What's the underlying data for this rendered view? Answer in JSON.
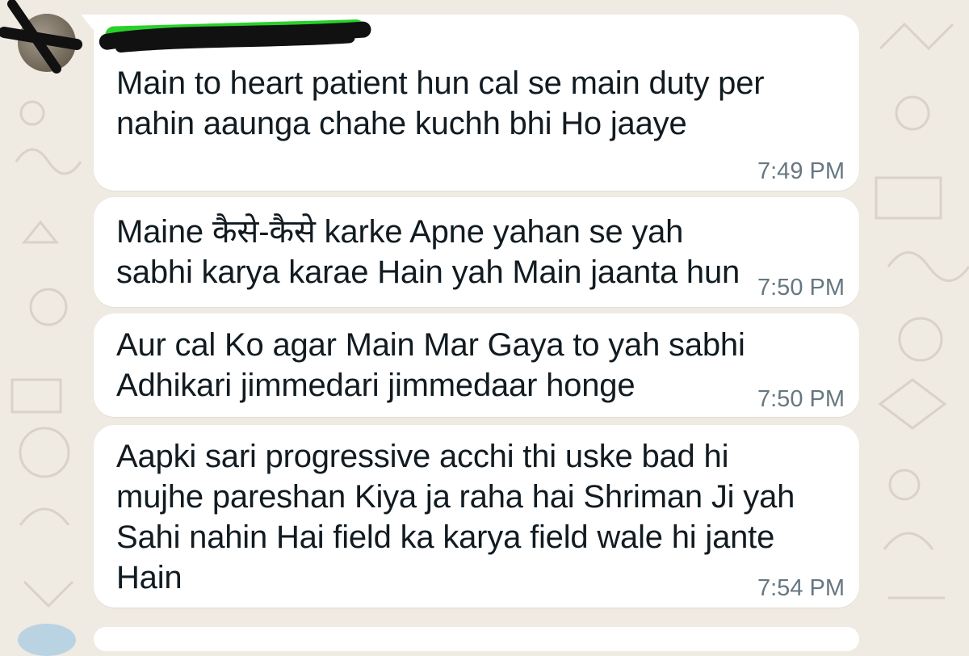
{
  "chat": {
    "sender_name": "",
    "messages": [
      {
        "text": "Main to heart patient hun cal se main duty per nahin aaunga chahe kuchh bhi Ho jaaye",
        "time": "7:49 PM"
      },
      {
        "text": "Maine कैसे-कैसे karke Apne yahan se yah sabhi karya karae Hain yah Main jaanta hun",
        "time": "7:50 PM"
      },
      {
        "text": "Aur cal Ko agar Main Mar Gaya to yah sabhi Adhikari jimmedari jimmedaar honge",
        "time": "7:50 PM"
      },
      {
        "text": "Aapki sari progressive acchi thi uske bad hi mujhe pareshan Kiya ja raha hai Shriman Ji yah Sahi nahin Hai field ka karya field wale hi jante Hain",
        "time": "7:54 PM"
      }
    ]
  },
  "colors": {
    "background": "#efeae2",
    "bubble": "#ffffff",
    "text": "#111b21",
    "timestamp": "#667781",
    "redaction_black": "#111111",
    "redaction_green": "#2ad02a"
  }
}
